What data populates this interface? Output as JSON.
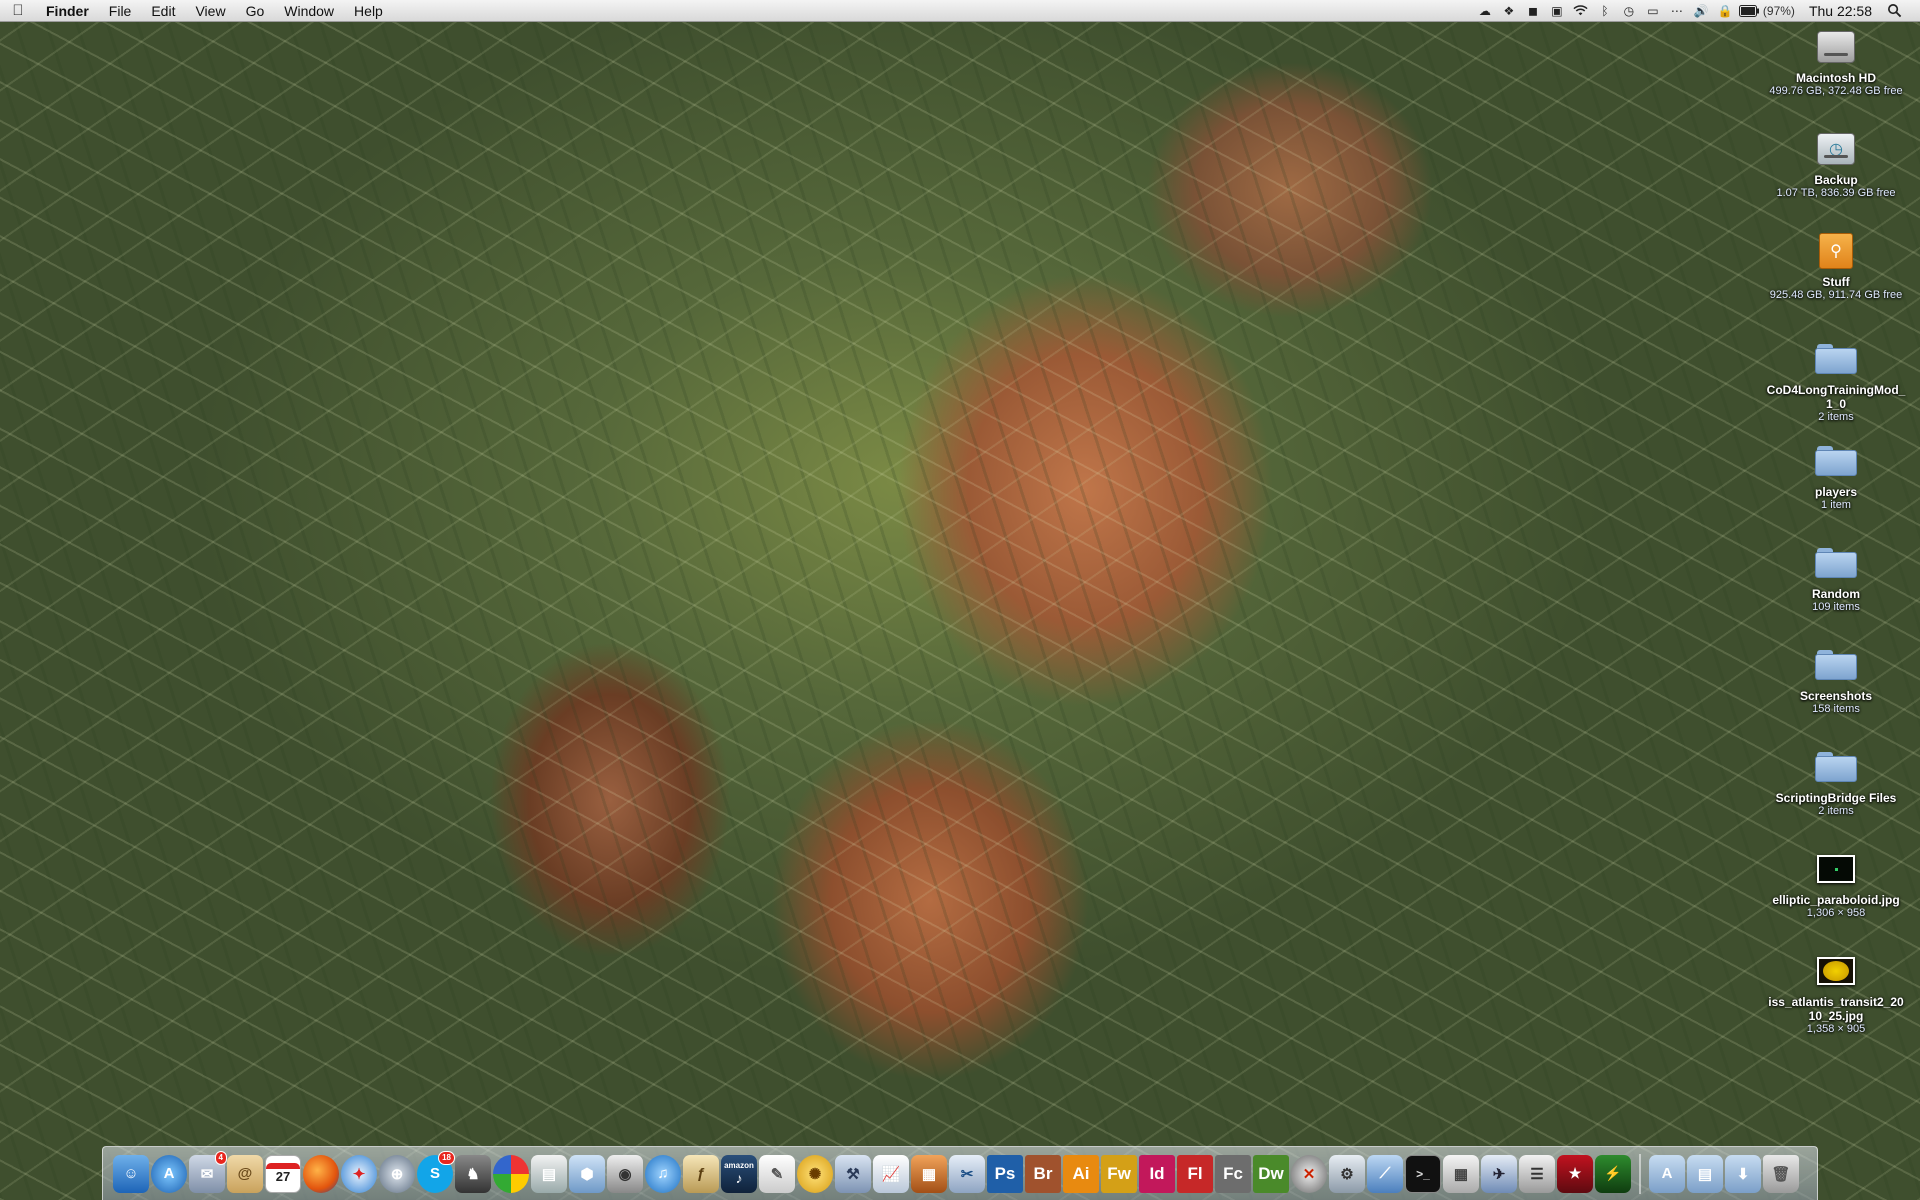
{
  "menubar": {
    "app_name": "Finder",
    "menus": [
      "File",
      "Edit",
      "View",
      "Go",
      "Window",
      "Help"
    ],
    "battery_percent": "(97%)",
    "clock": "Thu 22:58"
  },
  "desktop_icons": [
    {
      "name": "Macintosh HD",
      "sub": "499.76 GB, 372.48 GB free",
      "kind": "hard-drive"
    },
    {
      "name": "Backup",
      "sub": "1.07 TB, 836.39 GB free",
      "kind": "time-machine-drive"
    },
    {
      "name": "Stuff",
      "sub": "925.48 GB, 911.74 GB free",
      "kind": "usb-drive"
    },
    {
      "name": "CoD4LongTrainingMod_1_0",
      "sub": "2 items",
      "kind": "folder"
    },
    {
      "name": "players",
      "sub": "1 item",
      "kind": "folder"
    },
    {
      "name": "Random",
      "sub": "109 items",
      "kind": "folder"
    },
    {
      "name": "Screenshots",
      "sub": "158 items",
      "kind": "folder"
    },
    {
      "name": "ScriptingBridge Files",
      "sub": "2 items",
      "kind": "folder"
    },
    {
      "name": "elliptic_paraboloid.jpg",
      "sub": "1,306 × 958",
      "kind": "image-dark"
    },
    {
      "name": "iss_atlantis_transit2_2010_25.jpg",
      "sub": "1,358 × 905",
      "kind": "image-sun"
    }
  ],
  "dock": {
    "adobe_labels": [
      "Ps",
      "Br",
      "Ai",
      "Fw",
      "Id",
      "Fl",
      "Fc",
      "Dw"
    ],
    "calendar_day": "27",
    "mail_badge": "4",
    "skype_badge": "18",
    "amazon_label": "amazon",
    "colors": {
      "ps": "#1f5fa8",
      "br": "#a0522d",
      "ai": "#e88a10",
      "fw": "#d4a017",
      "id": "#c2185b",
      "fl": "#c62828",
      "fc": "#6d6d6d",
      "dw": "#4a8a2a"
    }
  }
}
